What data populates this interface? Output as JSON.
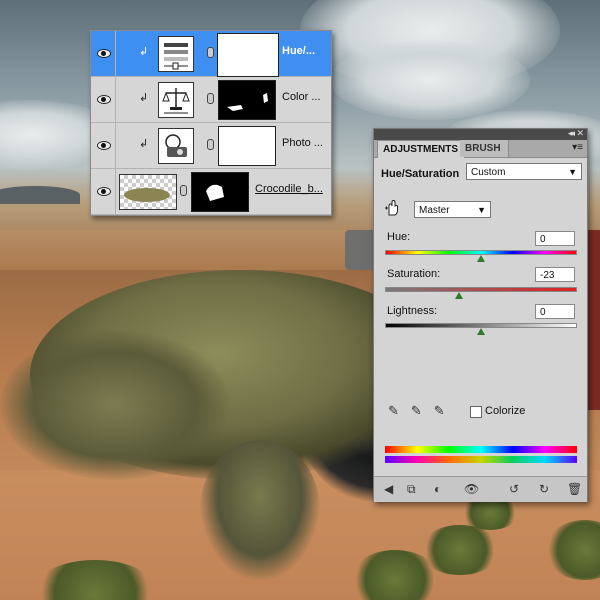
{
  "layers_panel": {
    "rows": [
      {
        "name": "Hue/...",
        "selected": true,
        "clipped": true,
        "clip_glyph": "↲",
        "thumb_icon": "hue-saturation-adjustment-icon"
      },
      {
        "name": "Color ...",
        "selected": false,
        "clipped": true,
        "clip_glyph": "↲",
        "thumb_icon": "color-balance-adjustment-icon"
      },
      {
        "name": "Photo ...",
        "selected": false,
        "clipped": true,
        "clip_glyph": "↲",
        "thumb_icon": "photo-filter-adjustment-icon"
      },
      {
        "name": "Crocodile_b...",
        "selected": false,
        "clipped": false,
        "thumb_icon": "crocodile-thumbnail"
      }
    ]
  },
  "adjustments": {
    "tab_active": "ADJUSTMENTS",
    "tab_inactive": "BRUSH",
    "panel_menu_glyph": "▾≡",
    "collapse_glyph": "◂◂",
    "close_glyph": "✕",
    "title": "Hue/Saturation",
    "preset": "Custom",
    "channel": "Master",
    "hue_label": "Hue:",
    "hue_value": "0",
    "saturation_label": "Saturation:",
    "saturation_value": "-23",
    "lightness_label": "Lightness:",
    "lightness_value": "0",
    "hue_slider_fraction": 0.5,
    "saturation_slider_fraction": 0.385,
    "lightness_slider_fraction": 0.5,
    "colorize_label": "Colorize",
    "colorize_checked": false,
    "select_arrow": "▼",
    "eyedropper_glyphs": "✎✎✎"
  },
  "colors": {
    "selection_blue": "#3f8ff0",
    "panel_gray": "#d4d4d4",
    "slider_thumb_green": "#2f7a2f"
  }
}
